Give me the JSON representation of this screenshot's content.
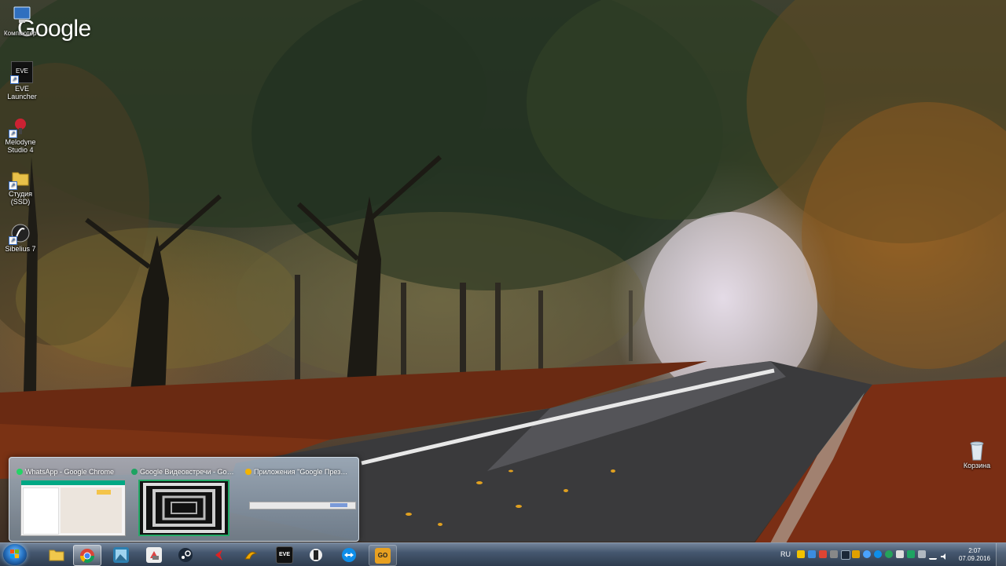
{
  "desktop": {
    "google_logo": "Google",
    "icons": [
      {
        "label": "Компьютер",
        "icon": "computer-icon"
      },
      {
        "label": "EVE Launcher",
        "icon": "eve-launcher-icon",
        "badge": "EVE"
      },
      {
        "label": "Melodyne Studio 4",
        "line1": "Melodyne",
        "line2": "Studio 4",
        "icon": "melodyne-icon"
      },
      {
        "label": "Студия (SSD)",
        "icon": "folder-icon"
      },
      {
        "label": "Sibelius 7",
        "icon": "sibelius-icon"
      },
      {
        "label": "Корзина",
        "icon": "recycle-bin-icon"
      }
    ]
  },
  "preview": {
    "thumbnails": [
      {
        "title": "WhatsApp - Google Chrome",
        "favicon_color": "#25d366"
      },
      {
        "title": "Google Видеовстречи - Google...",
        "favicon_color": "#1ea362"
      },
      {
        "title": "Приложения \"Google Презент...",
        "favicon_color": "#f4b400"
      }
    ]
  },
  "taskbar": {
    "apps": [
      {
        "name": "Windows Explorer",
        "icon": "folder-icon",
        "glyph": ""
      },
      {
        "name": "Google Chrome",
        "icon": "chrome-icon",
        "glyph": ""
      },
      {
        "name": "Photo",
        "icon": "photo-icon",
        "glyph": ""
      },
      {
        "name": "App",
        "icon": "app-icon",
        "glyph": ""
      },
      {
        "name": "Steam",
        "icon": "steam-icon",
        "glyph": ""
      },
      {
        "name": "Arrow",
        "icon": "arrow-app-icon",
        "glyph": ""
      },
      {
        "name": "Raptr",
        "icon": "raptr-icon",
        "glyph": ""
      },
      {
        "name": "EVE",
        "icon": "eve-icon",
        "glyph": "EVE"
      },
      {
        "name": "Figure",
        "icon": "figure-icon",
        "glyph": ""
      },
      {
        "name": "TeamViewer",
        "icon": "teamviewer-icon",
        "glyph": ""
      },
      {
        "name": "CS:GO",
        "icon": "csgo-icon",
        "glyph": "GO"
      }
    ],
    "tray": {
      "language": "RU",
      "time": "2:07",
      "date": "07.09.2016"
    }
  },
  "colors": {
    "taskbar_top": "#788ca5",
    "taskbar_bottom": "#2d3c50",
    "chrome_red": "#db4437",
    "chrome_yellow": "#f4b400",
    "chrome_green": "#0f9d58",
    "chrome_blue": "#4285f4",
    "csgo_orange": "#e8a020"
  }
}
